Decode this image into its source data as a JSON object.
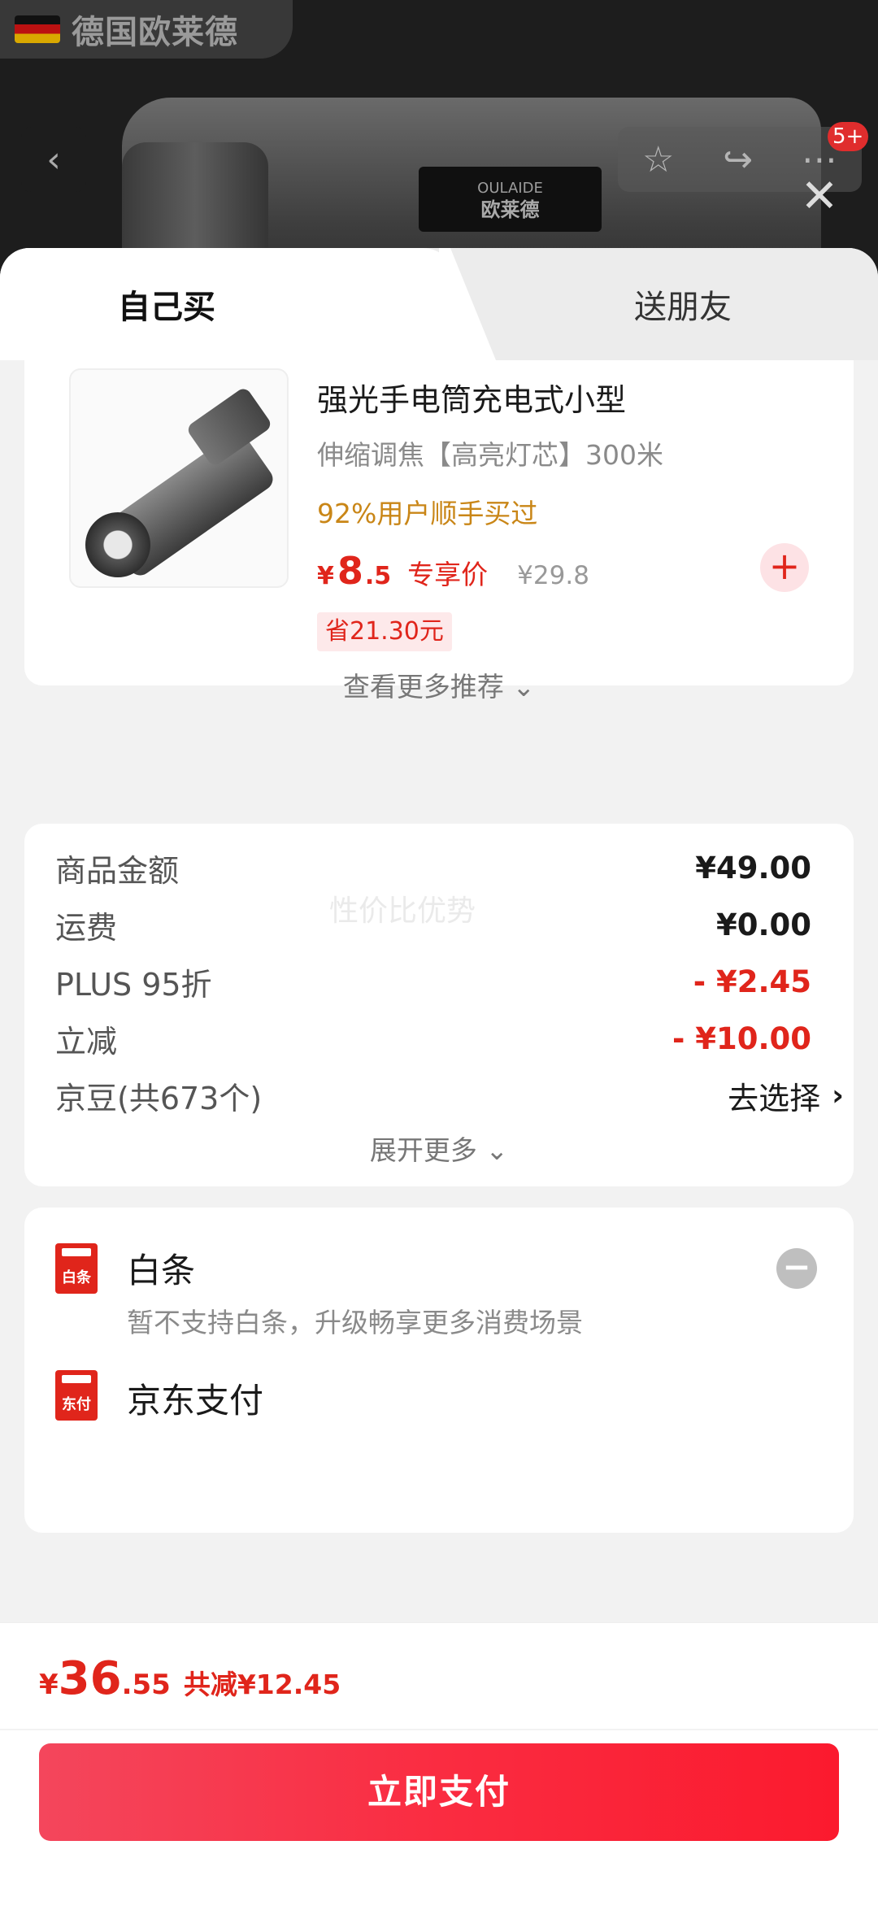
{
  "backdrop": {
    "store_name": "德国欧莱德",
    "brand_plate_top": "OULAIDE",
    "brand_plate_bottom": "欧莱德",
    "notification_badge": "5+"
  },
  "tabs": {
    "self": "自己买",
    "friend": "送朋友"
  },
  "product": {
    "title": "强光手电筒充电式小型",
    "spec": "伸缩调焦【高亮灯芯】300米",
    "hint": "92%用户顺手买过",
    "price_currency": "¥",
    "price_int": "8",
    "price_dec": ".5",
    "price_tag": "专享价",
    "original_price": "¥29.8",
    "save_badge": "省21.30元",
    "more_recommend": "查看更多推荐 ⌄"
  },
  "fees": {
    "watermark": "性价比优势",
    "rows": [
      {
        "label": "商品金额",
        "value": "¥49.00"
      },
      {
        "label": "运费",
        "value": "¥0.00"
      },
      {
        "label": "PLUS 95折",
        "value": "- ¥2.45"
      },
      {
        "label": "立减",
        "value": "- ¥10.00"
      },
      {
        "label": "京豆(共673个)",
        "value": "去选择"
      }
    ],
    "expand_more": "展开更多 ⌄"
  },
  "payment": {
    "baitiao": {
      "icon_text": "白条",
      "title": "白条",
      "subtitle": "暂不支持白条，升级畅享更多消费场景"
    },
    "jdpay": {
      "icon_text": "东付",
      "title": "京东支付"
    }
  },
  "footer": {
    "currency": "¥",
    "total_int": "36",
    "total_dec": ".55",
    "total_save": "共减¥12.45",
    "pay_button": "立即支付"
  },
  "colors": {
    "accent_red": "#e0251b",
    "hint_orange": "#c98617",
    "pay_gradient_start": "#f4465c",
    "pay_gradient_end": "#fb1a2e"
  },
  "icons": [
    "back-arrow-icon",
    "star-icon",
    "share-icon",
    "more-dots-icon",
    "close-icon",
    "plus-icon",
    "minus-icon",
    "chevron-right-icon"
  ]
}
